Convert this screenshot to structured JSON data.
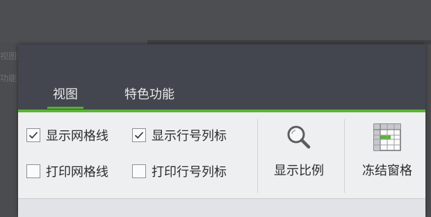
{
  "background": {
    "fragment_1": "视图选",
    "fragment_2": "功能"
  },
  "tabs": [
    {
      "label": "视图",
      "active": true
    },
    {
      "label": "特色功能",
      "active": false
    }
  ],
  "checkboxes": {
    "show_gridlines": {
      "label": "显示网格线",
      "checked": true
    },
    "show_headers": {
      "label": "显示行号列标",
      "checked": true
    },
    "print_gridlines": {
      "label": "打印网格线",
      "checked": false
    },
    "print_headers": {
      "label": "打印行号列标",
      "checked": false
    }
  },
  "buttons": {
    "zoom": {
      "label": "显示比例",
      "icon": "magnifier-icon"
    },
    "freeze": {
      "label": "冻结窗格",
      "icon": "freeze-panes-icon"
    }
  },
  "colors": {
    "accent": "#59b532",
    "tabbar": "#43464f",
    "ribbon": "#eeeff1"
  }
}
